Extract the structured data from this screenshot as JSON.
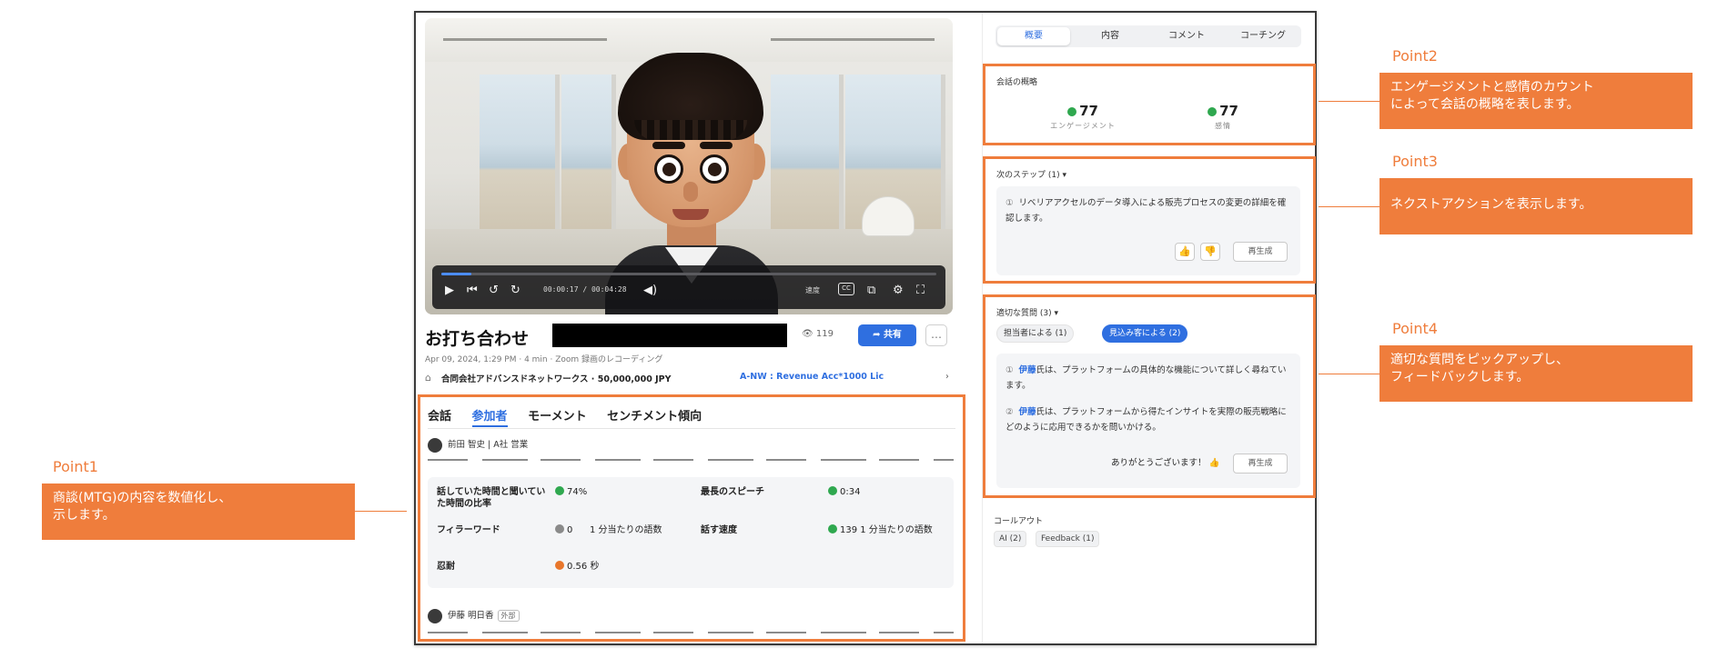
{
  "annotations": [
    {
      "head": "Point1",
      "lines": [
        "商談(MTG)の内容を数値化し、",
        "示します。"
      ]
    },
    {
      "head": "Point2",
      "lines": [
        "エンゲージメントと感情のカウント",
        "によって会話の概略を表します。"
      ]
    },
    {
      "head": "Point3",
      "lines": [
        "ネクストアクションを表示します。"
      ]
    },
    {
      "head": "Point4",
      "lines": [
        "適切な質問をピックアップし、",
        "フィードバックします。"
      ]
    }
  ],
  "video": {
    "progress": 0.06,
    "time_current": "00:00:17",
    "time_total": "00:04:28",
    "speed_label": "速度",
    "cc_label": "CC"
  },
  "meeting": {
    "title": "お打ち合わせ",
    "views": "119",
    "share_label": "共有",
    "more_label": "…",
    "meta": "Apr 09, 2024, 1:29 PM · 4 min · Zoom 録画のレコーディング",
    "deal_name": "合同会社アドバンスドネットワークス · 50,000,000 JPY",
    "deal_link": "A-NW : Revenue Acc*1000 Lic",
    "deal_arrow": "›"
  },
  "participants_tabs": [
    "会話",
    "参加者",
    "モーメント",
    "センチメント傾向"
  ],
  "participants": [
    {
      "name": "前田 智史 | A社 営業"
    },
    {
      "name": "伊藤 明日香",
      "tag": "外部"
    }
  ],
  "stats": {
    "talk_ratio_label": "話していた時間と聞いていた時間の比率",
    "talk_ratio_value": "74%",
    "longest_speech_label": "最長のスピーチ",
    "longest_speech_value": "0:34",
    "filler_label": "フィラーワード",
    "filler_count": "0",
    "filler_unit": "1 分当たりの語数",
    "speed_label": "話す速度",
    "speed_value": "139 1 分当たりの語数",
    "patience_label": "忍耐",
    "patience_value": "0.56 秒"
  },
  "right_tabs": [
    "概要",
    "内容",
    "コメント",
    "コーチング"
  ],
  "summary": {
    "title": "会話の概略",
    "engagement_value": "77",
    "engagement_label": "エンゲージメント",
    "sentiment_value": "77",
    "sentiment_label": "感情"
  },
  "next_steps": {
    "title": "次のステップ (1)",
    "item": "リベリアアクセルのデータ導入による販売プロセスの変更の詳細を確認します。",
    "regen_label": "再生成"
  },
  "questions": {
    "title": "適切な質問 (3)",
    "filter_1": "担当者による (1)",
    "filter_2": "見込み客による (2)",
    "q1_name": "伊藤",
    "q1_text": "氏は、プラットフォームの具体的な機能について詳しく尋ねています。",
    "q2_name": "伊藤",
    "q2_text": "氏は、プラットフォームから得たインサイトを実際の販売戦略にどのように応用できるかを問いかける。",
    "thanks": "ありがとうございます！",
    "regen_label": "再生成"
  },
  "callouts": {
    "title": "コールアウト",
    "chip_1": "AI (2)",
    "chip_2": "Feedback (1)"
  },
  "colors": {
    "accent": "#ef7d3c",
    "primary": "#2f6fe0",
    "positive": "#2fa84f",
    "warning": "#e8762b"
  }
}
